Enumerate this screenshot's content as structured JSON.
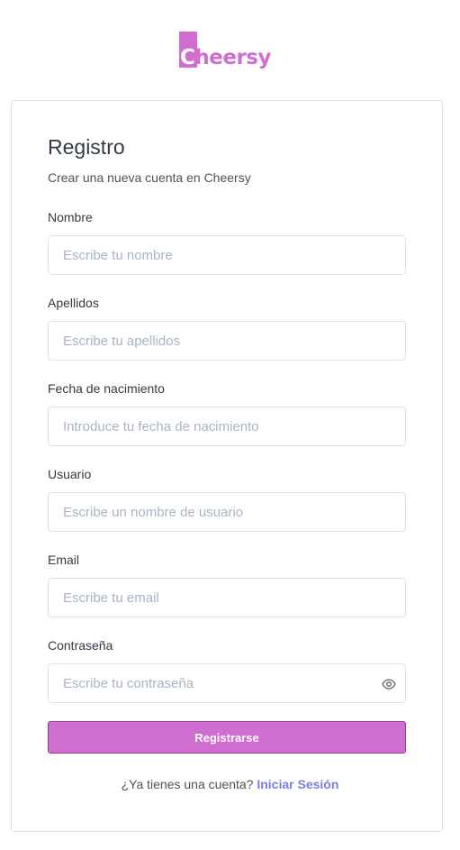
{
  "brand": {
    "name": "Cheersy",
    "color": "#d06dd1"
  },
  "form": {
    "title": "Registro",
    "subtitle": "Crear una nueva cuenta en Cheersy",
    "fields": {
      "nombre": {
        "label": "Nombre",
        "placeholder": "Escribe tu nombre",
        "value": ""
      },
      "apellidos": {
        "label": "Apellidos",
        "placeholder": "Escribe tu apellidos",
        "value": ""
      },
      "fecha": {
        "label": "Fecha de nacimiento",
        "placeholder": "Introduce tu fecha de nacimiento",
        "value": ""
      },
      "usuario": {
        "label": "Usuario",
        "placeholder": "Escribe un nombre de usuario",
        "value": ""
      },
      "email": {
        "label": "Email",
        "placeholder": "Escribe tu email",
        "value": ""
      },
      "password": {
        "label": "Contraseña",
        "placeholder": "Escribe tu contraseña",
        "value": "",
        "toggle_icon": "eye-icon"
      }
    },
    "submit_label": "Registrarse"
  },
  "footer": {
    "prompt": "¿Ya tienes una cuenta?",
    "link_label": "Iniciar Sesión"
  }
}
